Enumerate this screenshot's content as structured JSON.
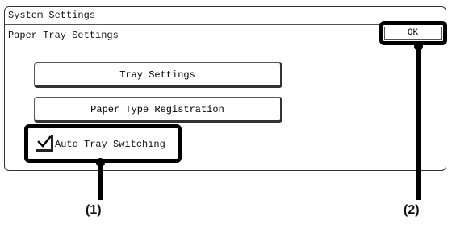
{
  "window": {
    "title": "System Settings",
    "subtitle": "Paper Tray Settings",
    "ok_label": "OK"
  },
  "buttons": {
    "tray_settings": "Tray Settings",
    "paper_type_registration": "Paper Type Registration"
  },
  "auto_tray": {
    "label": "Auto Tray Switching",
    "checked": true
  },
  "callouts": {
    "one": "(1)",
    "two": "(2)"
  },
  "icons": {
    "check": "check-icon"
  },
  "colors": {
    "highlight": "#000000",
    "border": "#555555",
    "background": "#ffffff"
  }
}
